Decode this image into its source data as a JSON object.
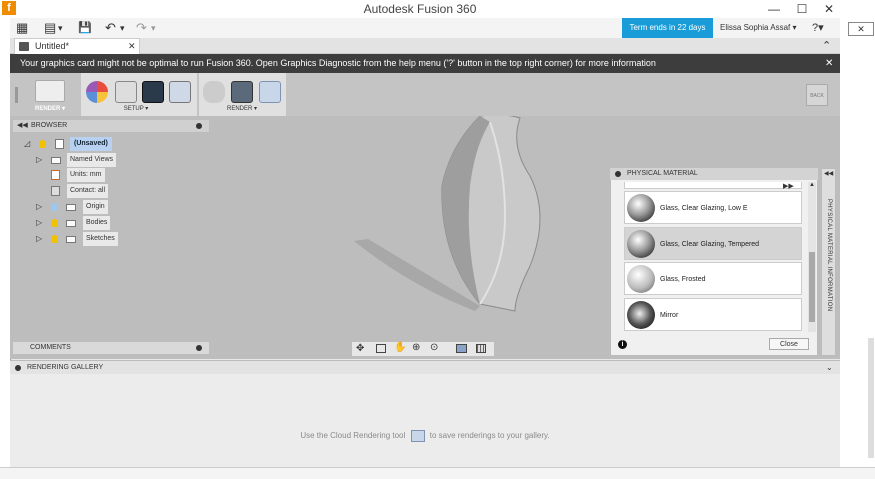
{
  "window": {
    "title": "Autodesk Fusion 360",
    "minimize": "—",
    "maximize": "☐",
    "close": "✕"
  },
  "qat": {
    "grid_icon": "▦",
    "file_icon": "▤",
    "save_icon": "💾",
    "undo_icon": "↶",
    "redo_icon": "↷",
    "dropdown": "▾"
  },
  "account": {
    "term": "Term ends in 22 days",
    "user": "Elissa Sophia Assaf ▾",
    "help": "?▾"
  },
  "document": {
    "tab_label": "Untitled*",
    "close": "✕",
    "expand": "⌃"
  },
  "warning": {
    "text": "Your graphics card might not be optimal to run Fusion 360. Open Graphics Diagnostic from the help menu ('?' button in the top right corner) for more information",
    "close": "✕"
  },
  "toolbar": {
    "render_workspace": "RENDER ▾",
    "setup_label": "SETUP ▾",
    "render_label": "RENDER ▾",
    "back_label": "BACK"
  },
  "browser": {
    "header": "BROWSER",
    "root": "(Unsaved)",
    "items": [
      {
        "label": "Named Views"
      },
      {
        "label": "Units: mm"
      },
      {
        "label": "Contact: all"
      },
      {
        "label": "Origin"
      },
      {
        "label": "Bodies"
      },
      {
        "label": "Sketches"
      }
    ]
  },
  "comments": {
    "label": "COMMENTS"
  },
  "material_panel": {
    "header": "PHYSICAL MATERIAL",
    "collapse": "◀◀",
    "info_icon": "i",
    "close_button": "Close",
    "side_tab": "PHYSICAL MATERIAL INFORMATION",
    "items": [
      {
        "label": "Glass, Clear Glazing, Low E"
      },
      {
        "label": "Glass, Clear Glazing, Tempered"
      },
      {
        "label": "Glass, Frosted"
      },
      {
        "label": "Mirror"
      }
    ]
  },
  "gallery": {
    "header": "RENDERING GALLERY",
    "message_before": "Use the Cloud Rendering tool",
    "message_after": "to save renderings to your gallery."
  },
  "colors": {
    "accent": "#1a9cd8",
    "warning_bg": "#3d3d3d",
    "selected": "#b8d1f0"
  }
}
